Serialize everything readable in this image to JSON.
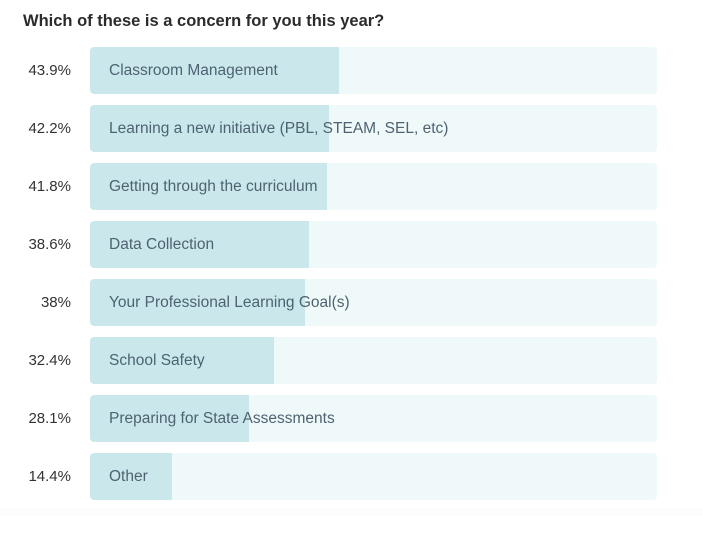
{
  "chart_data": {
    "type": "bar",
    "orientation": "horizontal",
    "title": "Which of these is a concern for you this year?",
    "xlim": [
      0,
      100
    ],
    "unit": "%",
    "categories": [
      "Classroom Management",
      "Learning a new initiative (PBL, STEAM, SEL, etc)",
      "Getting through the curriculum",
      "Data Collection",
      "Your Professional Learning Goal(s)",
      "School Safety",
      "Preparing for State Assessments",
      "Other"
    ],
    "values": [
      43.9,
      42.2,
      41.8,
      38.6,
      38,
      32.4,
      28.1,
      14.4
    ],
    "value_labels": [
      "43.9%",
      "42.2%",
      "41.8%",
      "38.6%",
      "38%",
      "32.4%",
      "28.1%",
      "14.4%"
    ],
    "colors": {
      "fill": "#cae8eb",
      "track": "#f0f9f9",
      "label": "#4e6272"
    }
  }
}
